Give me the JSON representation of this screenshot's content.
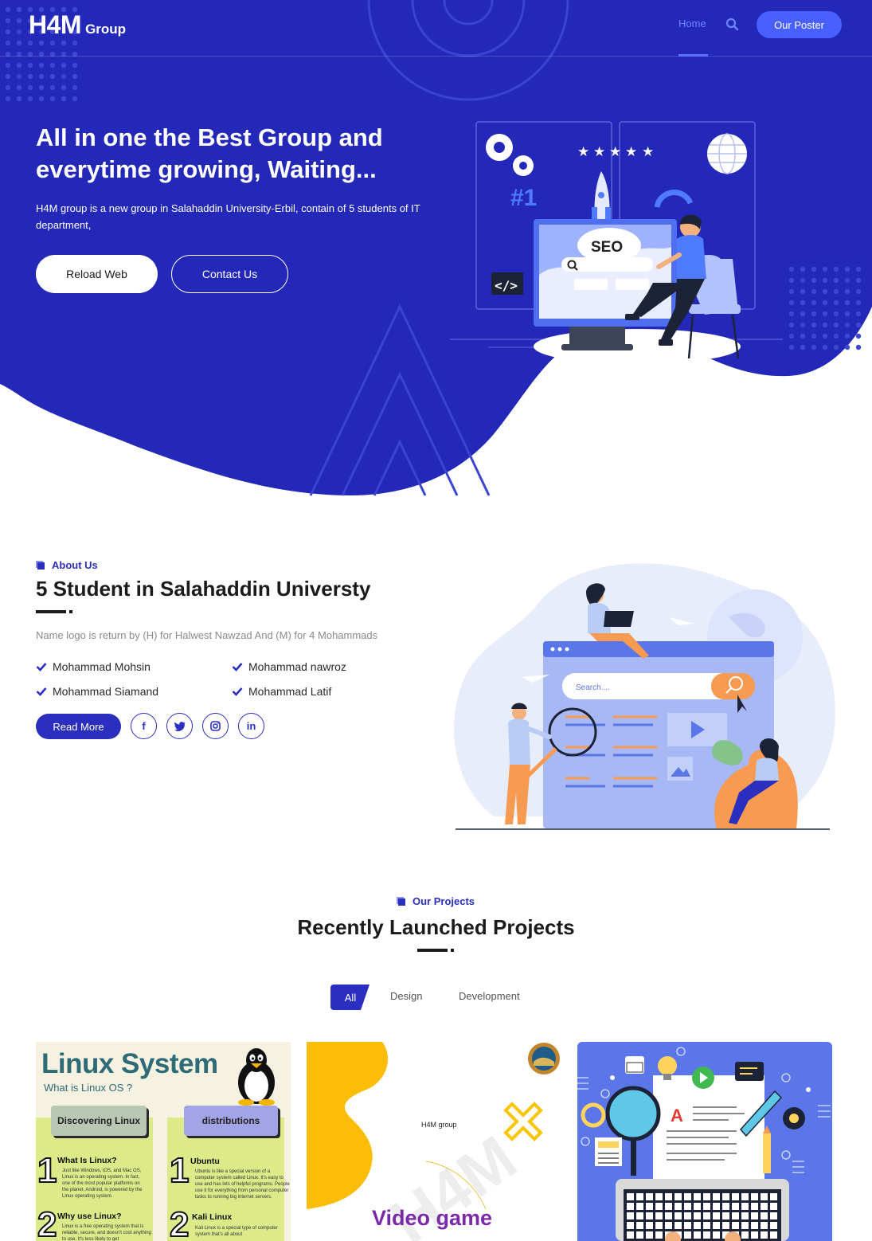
{
  "header": {
    "logo_main": "H4M",
    "logo_sub": "Group",
    "nav_home": "Home",
    "poster_button": "Our Poster"
  },
  "hero": {
    "title": "All in one the Best Group and everytime growing, Waiting...",
    "description": "H4M group is a new group in Salahaddin University-Erbil, contain of 5 students of IT department,",
    "reload_button": "Reload Web",
    "contact_button": "Contact Us",
    "illustration": {
      "badge": "#1",
      "seo_label": "SEO",
      "code_label": "</>"
    }
  },
  "about": {
    "tag": "About Us",
    "title": "5 Student in Salahaddin Universty",
    "description": "Name logo is return by (H) for Halwest Nawzad And (M) for 4 Mohammads",
    "members": [
      "Mohammad Mohsin",
      "Mohammad nawroz",
      "Mohammad Siamand",
      "Mohammad Latif"
    ],
    "read_more": "Read More",
    "social_icons": [
      "facebook-icon",
      "twitter-icon",
      "instagram-icon",
      "linkedin-icon"
    ],
    "illustration": {
      "search_placeholder": "Search...."
    }
  },
  "projects": {
    "tag": "Our Projects",
    "title": "Recently Launched Projects",
    "filters": [
      "All",
      "Design",
      "Development"
    ],
    "active_filter": "All",
    "cards": {
      "linux": {
        "title": "Linux System",
        "subtitle": "What is Linux OS ?",
        "col1_header": "Discovering Linux",
        "col2_header": "distributions",
        "item1_title": "What Is Linux?",
        "item1_text": "Just like Windows, iOS, and Mac OS, Linux is an operating system. In fact, one of the most popular platforms on the planet, Android, is powered by the Linux operating system.",
        "item2_title": "Why use Linux?",
        "item2_text": "Linux is a free operating system that is reliable, secure, and doesn't cost anything to use. It's less likely to get",
        "item3_title": "Ubuntu",
        "item3_text": "Ubuntu is like a special version of a computer system called Linux. It's easy to use and has lots of helpful programs. People use it for everything from personal computer tasks to running big internet servers.",
        "item4_title": "Kali Linux",
        "item4_text": "Kali Linux is a special type of computer system that's all about",
        "num1": "1",
        "num2": "2"
      },
      "video_game": {
        "brand": "H4M group",
        "title": "Video game",
        "watermark": "H4M"
      },
      "design": {
        "letter": "A"
      }
    }
  },
  "colors": {
    "hero_bg": "#2328b8",
    "accent": "#4760ff",
    "brand_dark": "#2b2fbf",
    "illus_orange": "#f79a52"
  }
}
